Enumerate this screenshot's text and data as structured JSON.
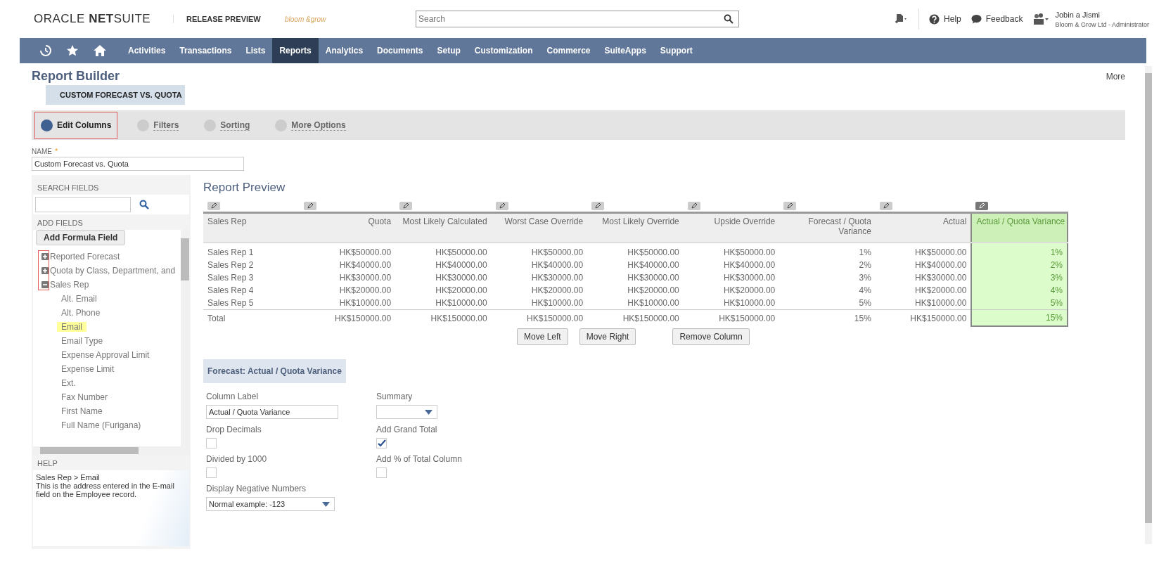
{
  "header": {
    "logo": "ORACLE **NET**SUITE",
    "release": "RELEASE PREVIEW",
    "partner_logo": "bloom &grow",
    "search": {
      "placeholder": "Search"
    },
    "help": "Help",
    "feedback": "Feedback",
    "user": {
      "name": "Jobin a Jismi",
      "account": "Bloom & Grow Ltd - Administrator"
    }
  },
  "nav": [
    {
      "label": "Activities",
      "selected": false
    },
    {
      "label": "Transactions",
      "selected": false
    },
    {
      "label": "Lists",
      "selected": false
    },
    {
      "label": "Reports",
      "selected": true
    },
    {
      "label": "Analytics",
      "selected": false
    },
    {
      "label": "Documents",
      "selected": false
    },
    {
      "label": "Setup",
      "selected": false
    },
    {
      "label": "Customization",
      "selected": false
    },
    {
      "label": "Commerce",
      "selected": false
    },
    {
      "label": "SuiteApps",
      "selected": false
    },
    {
      "label": "Support",
      "selected": false
    }
  ],
  "page": {
    "title": "Report Builder",
    "subtitle": "CUSTOM FORECAST VS. QUOTA",
    "more": "More"
  },
  "steps": [
    {
      "label": "Edit Columns",
      "selected": true
    },
    {
      "label": "Filters",
      "selected": false
    },
    {
      "label": "Sorting",
      "selected": false
    },
    {
      "label": "More Options",
      "selected": false
    }
  ],
  "name_field": {
    "label": "NAME",
    "required_mark": "*",
    "value": "Custom Forecast vs. Quota"
  },
  "sidebar": {
    "search_label": "SEARCH FIELDS",
    "add_label": "ADD FIELDS",
    "add_button": "Add Formula Field",
    "tree": [
      {
        "label": "Reported Forecast",
        "expanded": false
      },
      {
        "label": "Quota by Class, Department, and",
        "expanded": false
      },
      {
        "label": "Sales Rep",
        "expanded": true,
        "children": [
          {
            "label": "Alt. Email",
            "selected": false
          },
          {
            "label": "Alt. Phone",
            "selected": false
          },
          {
            "label": "Email",
            "selected": true
          },
          {
            "label": "Email Type",
            "selected": false
          },
          {
            "label": "Expense Approval Limit",
            "selected": false
          },
          {
            "label": "Expense Limit",
            "selected": false
          },
          {
            "label": "Ext.",
            "selected": false
          },
          {
            "label": "Fax Number",
            "selected": false
          },
          {
            "label": "First Name",
            "selected": false
          },
          {
            "label": "Full Name (Furigana)",
            "selected": false
          }
        ]
      }
    ],
    "help_label": "HELP",
    "help_path": "Sales Rep > Email",
    "help_text": "This is the address entered in the E-mail field on the Employee record."
  },
  "preview": {
    "title": "Report Preview",
    "columns": [
      {
        "label": "Sales Rep",
        "selected": false
      },
      {
        "label": "Quota",
        "selected": false
      },
      {
        "label": "Most Likely Calculated",
        "selected": false
      },
      {
        "label": "Worst Case Override",
        "selected": false
      },
      {
        "label": "Most Likely Override",
        "selected": false
      },
      {
        "label": "Upside Override",
        "selected": false
      },
      {
        "label": "Forecast / Quota Variance",
        "selected": false
      },
      {
        "label": "Actual",
        "selected": false
      },
      {
        "label": "Actual / Quota Variance",
        "selected": true
      }
    ],
    "rows": [
      [
        "Sales Rep 1",
        "HK$50000.00",
        "HK$50000.00",
        "HK$50000.00",
        "HK$50000.00",
        "HK$50000.00",
        "1%",
        "HK$50000.00",
        "1%"
      ],
      [
        "Sales Rep 2",
        "HK$40000.00",
        "HK$40000.00",
        "HK$40000.00",
        "HK$40000.00",
        "HK$40000.00",
        "2%",
        "HK$40000.00",
        "2%"
      ],
      [
        "Sales Rep 3",
        "HK$30000.00",
        "HK$30000.00",
        "HK$30000.00",
        "HK$30000.00",
        "HK$30000.00",
        "3%",
        "HK$30000.00",
        "3%"
      ],
      [
        "Sales Rep 4",
        "HK$20000.00",
        "HK$20000.00",
        "HK$20000.00",
        "HK$20000.00",
        "HK$20000.00",
        "4%",
        "HK$20000.00",
        "4%"
      ],
      [
        "Sales Rep 5",
        "HK$10000.00",
        "HK$10000.00",
        "HK$10000.00",
        "HK$10000.00",
        "HK$10000.00",
        "5%",
        "HK$10000.00",
        "5%"
      ]
    ],
    "total": [
      "Total",
      "HK$150000.00",
      "HK$150000.00",
      "HK$150000.00",
      "HK$150000.00",
      "HK$150000.00",
      "15%",
      "HK$150000.00",
      "15%"
    ],
    "buttons": [
      "Move Left",
      "Move Right",
      "Remove Column"
    ]
  },
  "column_form": {
    "title": "Forecast: Actual / Quota Variance",
    "fields": [
      {
        "kind": "text",
        "label": "Column Label",
        "value": "Actual / Quota Variance"
      },
      {
        "kind": "select",
        "label": "Summary"
      },
      {
        "kind": "checkbox",
        "label": "Drop Decimals",
        "checked": false
      },
      {
        "kind": "checkbox",
        "label": "Add Grand Total",
        "checked": true
      },
      {
        "kind": "checkbox",
        "label": "Divided by 1000",
        "checked": false
      },
      {
        "kind": "checkbox",
        "label": "Add % of Total Column",
        "checked": false
      },
      {
        "kind": "select",
        "label": "Display Negative Numbers",
        "value": "Normal  example: -123"
      }
    ]
  }
}
